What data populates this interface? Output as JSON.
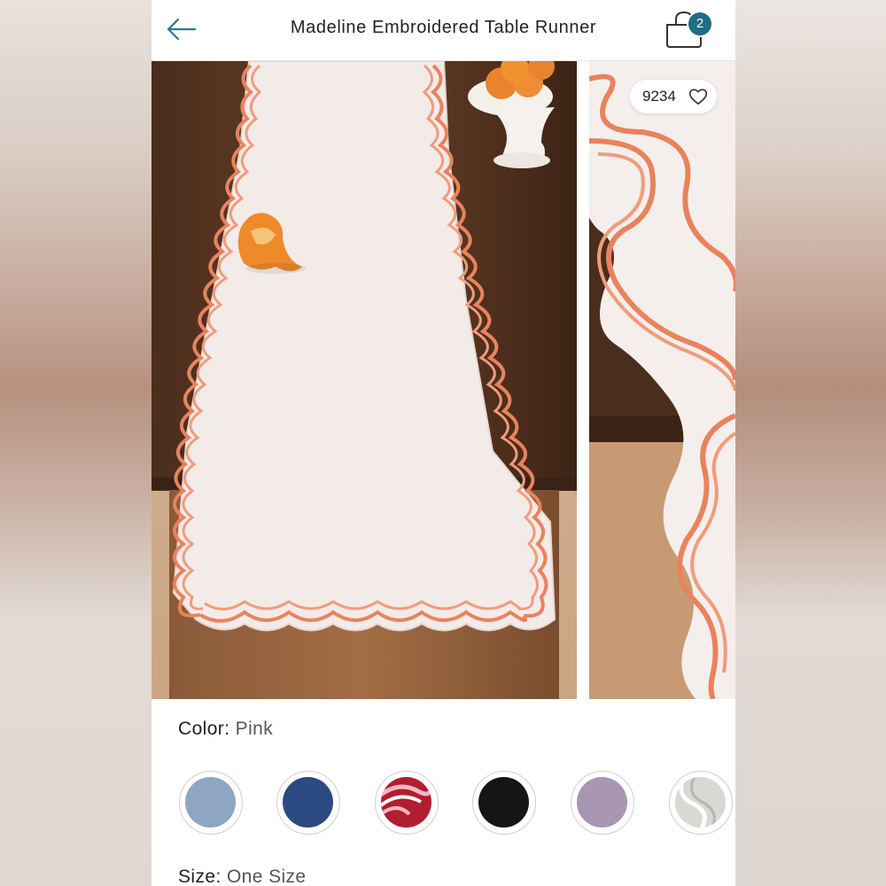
{
  "header": {
    "title": "Madeline Embroidered Table Runner",
    "cart_count": "2"
  },
  "gallery": {
    "like_count": "9234"
  },
  "options": {
    "color_label": "Color:",
    "color_value": "Pink",
    "size_label": "Size:",
    "size_value": "One Size",
    "swatches": [
      {
        "name": "light-blue",
        "color": "#8fa5c4"
      },
      {
        "name": "navy",
        "color": "#2c4a82"
      },
      {
        "name": "red-pink",
        "color": "#b21d2f"
      },
      {
        "name": "black",
        "color": "#151515"
      },
      {
        "name": "lavender",
        "color": "#a896b2"
      },
      {
        "name": "white-gray",
        "color": "#d9d8d5"
      }
    ]
  },
  "colors": {
    "accent": "#1f6d86",
    "embroidery": "#e5825f"
  }
}
